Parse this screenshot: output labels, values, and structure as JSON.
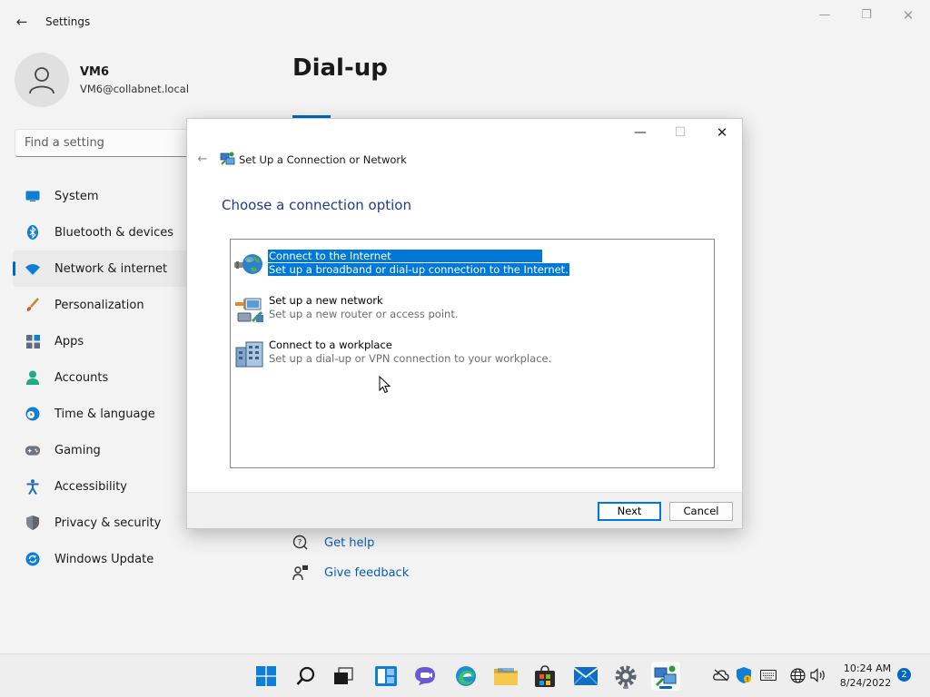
{
  "window": {
    "app_title": "Settings",
    "back_glyph": "←",
    "minimize_glyph": "—",
    "maximize_glyph": "❐",
    "close_glyph": "✕"
  },
  "user": {
    "name": "VM6",
    "email": "VM6@collabnet.local"
  },
  "search": {
    "placeholder": "Find a setting"
  },
  "nav": {
    "items": [
      {
        "label": "System",
        "icon": "monitor-icon"
      },
      {
        "label": "Bluetooth & devices",
        "icon": "bluetooth-icon"
      },
      {
        "label": "Network & internet",
        "icon": "wifi-icon",
        "selected": true
      },
      {
        "label": "Personalization",
        "icon": "brush-icon"
      },
      {
        "label": "Apps",
        "icon": "apps-icon"
      },
      {
        "label": "Accounts",
        "icon": "person-icon"
      },
      {
        "label": "Time & language",
        "icon": "clock-globe-icon"
      },
      {
        "label": "Gaming",
        "icon": "gamepad-icon"
      },
      {
        "label": "Accessibility",
        "icon": "accessibility-icon"
      },
      {
        "label": "Privacy & security",
        "icon": "shield-icon"
      },
      {
        "label": "Windows Update",
        "icon": "update-icon"
      }
    ]
  },
  "main": {
    "title": "Dial-up",
    "get_help": "Get help",
    "give_feedback": "Give feedback"
  },
  "dialog": {
    "title": "Set Up a Connection or Network",
    "heading": "Choose a connection option",
    "back_glyph": "←",
    "minimize_glyph": "—",
    "maximize_glyph": "☐",
    "close_glyph": "✕",
    "options": [
      {
        "title": "Connect to the Internet",
        "desc": "Set up a broadband or dial-up connection to the Internet.",
        "icon": "globe-network-icon",
        "selected": true
      },
      {
        "title": "Set up a new network",
        "desc": "Set up a new router or access point.",
        "icon": "router-setup-icon"
      },
      {
        "title": "Connect to a workplace",
        "desc": "Set up a dial-up or VPN connection to your workplace.",
        "icon": "workplace-icon"
      }
    ],
    "next_label": "Next",
    "cancel_label": "Cancel"
  },
  "taskbar": {
    "apps": [
      "start-icon",
      "search-icon",
      "task-view-icon",
      "widgets-icon",
      "chat-icon",
      "edge-icon",
      "file-explorer-icon",
      "store-icon",
      "mail-icon",
      "settings-gear-icon",
      "network-setup-icon"
    ],
    "clock_time": "10:24 AM",
    "clock_date": "8/24/2022",
    "notification_count": "2"
  },
  "colors": {
    "accent": "#0067c0",
    "selection": "#0078d7",
    "heading_blue": "#1e3c8c",
    "link_blue": "#0a5fb4"
  }
}
